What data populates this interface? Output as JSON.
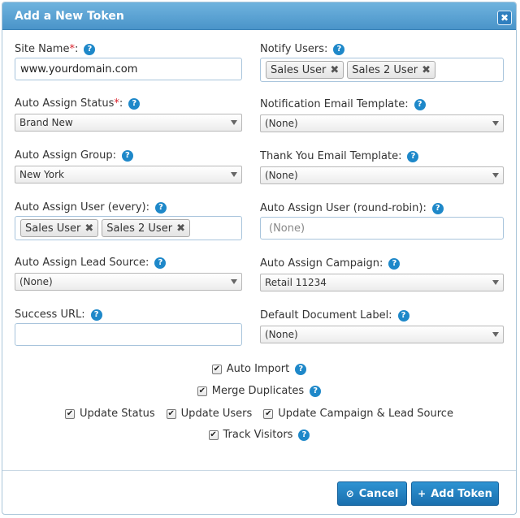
{
  "dialog": {
    "title": "Add a New Token",
    "close_symbol": "✖"
  },
  "help_symbol": "?",
  "required_mark": "*",
  "remove_symbol": "✖",
  "fields": {
    "site_name": {
      "label": "Site Name",
      "value": "www.yourdomain.com"
    },
    "notify_users": {
      "label": "Notify Users:",
      "tags": [
        "Sales User",
        "Sales 2 User"
      ]
    },
    "auto_assign_status": {
      "label": "Auto Assign Status",
      "value": "Brand New"
    },
    "notification_email_template": {
      "label": "Notification Email Template:",
      "value": "(None)"
    },
    "auto_assign_group": {
      "label": "Auto Assign Group:",
      "value": "New York"
    },
    "thank_you_email_template": {
      "label": "Thank You Email Template:",
      "value": "(None)"
    },
    "auto_assign_user_every": {
      "label": "Auto Assign User (every):",
      "tags": [
        "Sales User",
        "Sales 2 User"
      ]
    },
    "auto_assign_user_round_robin": {
      "label": "Auto Assign User (round-robin):",
      "placeholder": "(None)"
    },
    "auto_assign_lead_source": {
      "label": "Auto Assign Lead Source:",
      "value": "(None)"
    },
    "auto_assign_campaign": {
      "label": "Auto Assign Campaign:",
      "value": "Retail 11234"
    },
    "success_url": {
      "label": "Success URL:",
      "value": ""
    },
    "default_document_label": {
      "label": "Default Document Label:",
      "value": "(None)"
    }
  },
  "colon": ":",
  "checkboxes": {
    "auto_import": {
      "label": "Auto Import",
      "checked": true
    },
    "merge_duplicates": {
      "label": "Merge Duplicates",
      "checked": true
    },
    "update_status": {
      "label": "Update Status",
      "checked": true
    },
    "update_users": {
      "label": "Update Users",
      "checked": true
    },
    "update_campaign_lead_source": {
      "label": "Update Campaign & Lead Source",
      "checked": true
    },
    "track_visitors": {
      "label": "Track Visitors",
      "checked": true
    }
  },
  "check_symbol": "✔",
  "buttons": {
    "cancel": {
      "label": "Cancel",
      "icon": "⊘"
    },
    "add_token": {
      "label": "Add Token",
      "icon": "+"
    }
  },
  "colors": {
    "accent": "#1e88c9",
    "title_bar": "#5ba4d6",
    "required": "#d9232d"
  }
}
